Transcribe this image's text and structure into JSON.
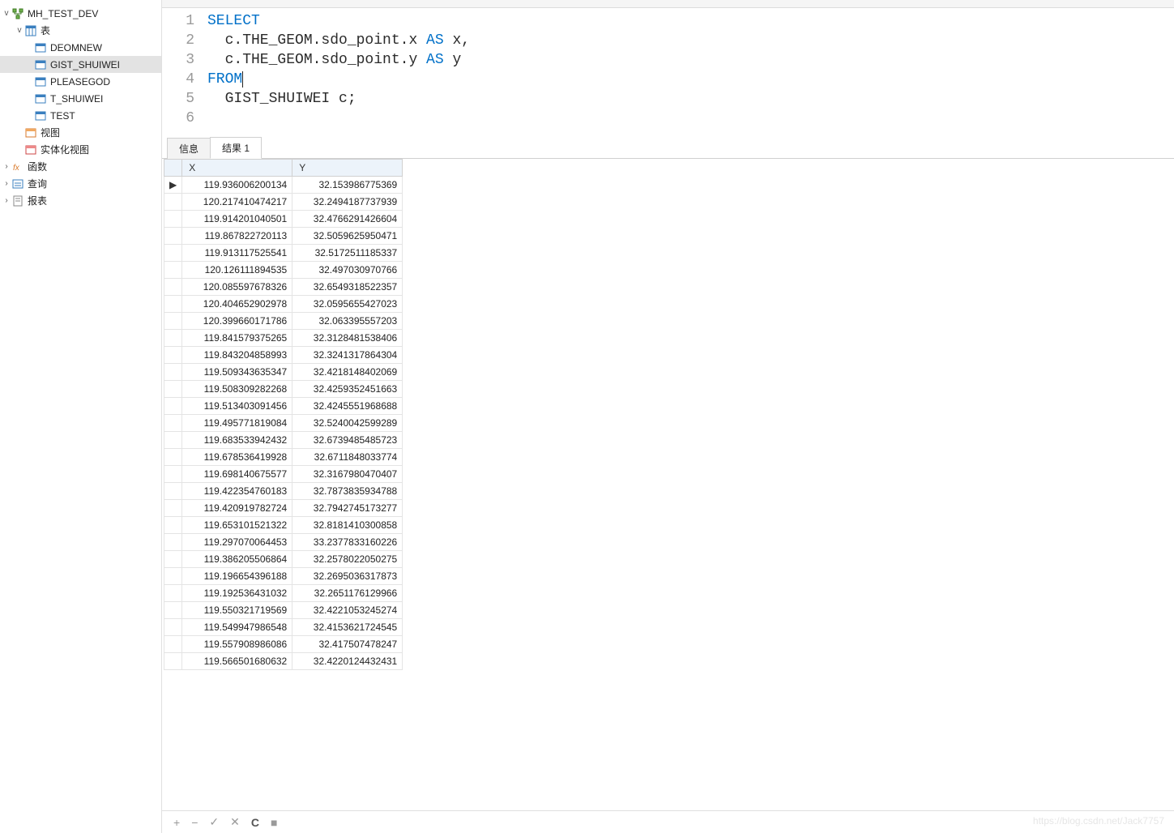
{
  "tree": {
    "schema": "MH_TEST_DEV",
    "tables_label": "表",
    "tables": [
      "DEOMNEW",
      "GIST_SHUIWEI",
      "PLEASEGOD",
      "T_SHUIWEI",
      "TEST"
    ],
    "selected_table": "GIST_SHUIWEI",
    "views_label": "视图",
    "matviews_label": "实体化视图",
    "functions_label": "函数",
    "queries_label": "查询",
    "reports_label": "报表"
  },
  "code": {
    "lines": [
      {
        "n": "1",
        "kw1": "SELECT",
        "rest": ""
      },
      {
        "n": "2",
        "kw1": "",
        "rest": "  c.THE_GEOM.sdo_point.x ",
        "kw2": "AS",
        "rest2": " x,"
      },
      {
        "n": "3",
        "kw1": "",
        "rest": "  c.THE_GEOM.sdo_point.y ",
        "kw2": "AS",
        "rest2": " y"
      },
      {
        "n": "4",
        "kw1": "FROM",
        "rest": ""
      },
      {
        "n": "5",
        "kw1": "",
        "rest": "  GIST_SHUIWEI c;"
      },
      {
        "n": "6",
        "kw1": "",
        "rest": ""
      }
    ]
  },
  "tabs": {
    "info": "信息",
    "result": "结果 1"
  },
  "grid": {
    "cols": [
      "X",
      "Y"
    ],
    "rows": [
      [
        "119.936006200134",
        "32.153986775369"
      ],
      [
        "120.217410474217",
        "32.2494187737939"
      ],
      [
        "119.914201040501",
        "32.4766291426604"
      ],
      [
        "119.867822720113",
        "32.5059625950471"
      ],
      [
        "119.913117525541",
        "32.5172511185337"
      ],
      [
        "120.126111894535",
        "32.497030970766"
      ],
      [
        "120.085597678326",
        "32.6549318522357"
      ],
      [
        "120.404652902978",
        "32.0595655427023"
      ],
      [
        "120.399660171786",
        "32.063395557203"
      ],
      [
        "119.841579375265",
        "32.3128481538406"
      ],
      [
        "119.843204858993",
        "32.3241317864304"
      ],
      [
        "119.509343635347",
        "32.4218148402069"
      ],
      [
        "119.508309282268",
        "32.4259352451663"
      ],
      [
        "119.513403091456",
        "32.4245551968688"
      ],
      [
        "119.495771819084",
        "32.5240042599289"
      ],
      [
        "119.683533942432",
        "32.6739485485723"
      ],
      [
        "119.678536419928",
        "32.6711848033774"
      ],
      [
        "119.698140675577",
        "32.3167980470407"
      ],
      [
        "119.422354760183",
        "32.7873835934788"
      ],
      [
        "119.420919782724",
        "32.7942745173277"
      ],
      [
        "119.653101521322",
        "32.8181410300858"
      ],
      [
        "119.297070064453",
        "33.2377833160226"
      ],
      [
        "119.386205506864",
        "32.2578022050275"
      ],
      [
        "119.196654396188",
        "32.2695036317873"
      ],
      [
        "119.192536431032",
        "32.2651176129966"
      ],
      [
        "119.550321719569",
        "32.4221053245274"
      ],
      [
        "119.549947986548",
        "32.4153621724545"
      ],
      [
        "119.557908986086",
        "32.417507478247"
      ],
      [
        "119.566501680632",
        "32.4220124432431"
      ]
    ]
  },
  "toolbar": {
    "add": "+",
    "remove": "−",
    "commit": "✓",
    "cancel": "✕",
    "refresh": "C",
    "stop": "■"
  },
  "watermark": "https://blog.csdn.net/Jack7757"
}
